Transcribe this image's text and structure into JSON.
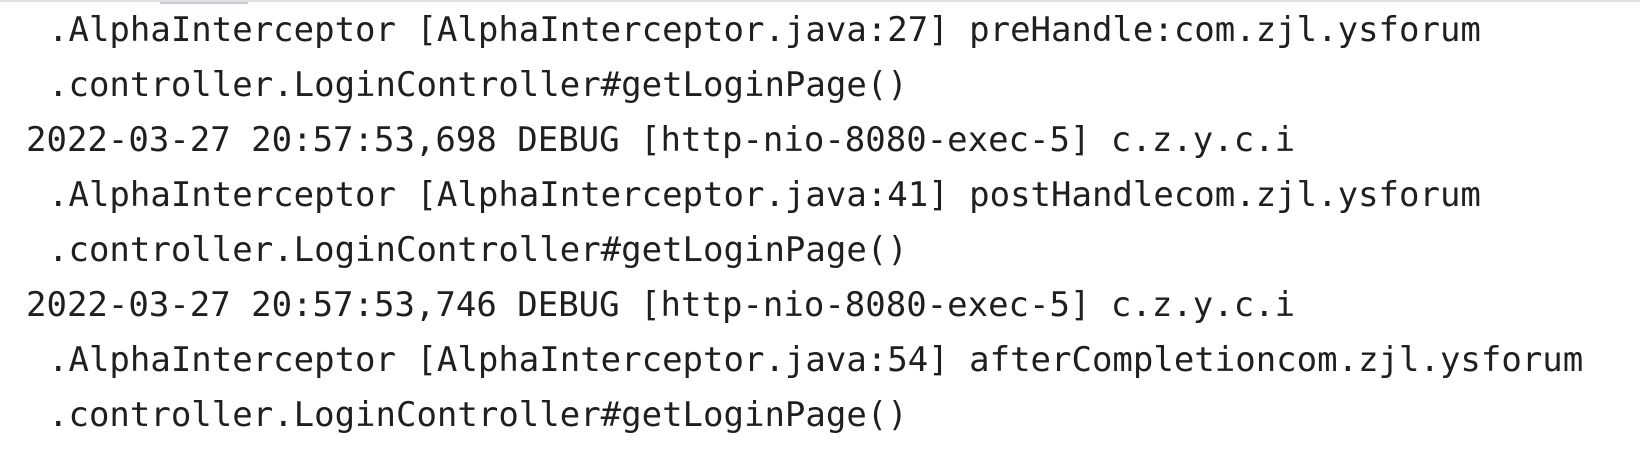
{
  "console": {
    "lines": [
      {
        "kind": "cont",
        "text": ".AlphaInterceptor [AlphaInterceptor.java:27] preHandle:com.zjl.ysforum"
      },
      {
        "kind": "cont",
        "text": ".controller.LoginController#getLoginPage()"
      },
      {
        "kind": "first",
        "text": "2022-03-27 20:57:53,698 DEBUG [http-nio-8080-exec-5] c.z.y.c.i"
      },
      {
        "kind": "cont",
        "text": ".AlphaInterceptor [AlphaInterceptor.java:41] postHandlecom.zjl.ysforum"
      },
      {
        "kind": "cont",
        "text": ".controller.LoginController#getLoginPage()"
      },
      {
        "kind": "first",
        "text": "2022-03-27 20:57:53,746 DEBUG [http-nio-8080-exec-5] c.z.y.c.i"
      },
      {
        "kind": "cont",
        "text": ".AlphaInterceptor [AlphaInterceptor.java:54] afterCompletioncom.zjl.ysforum"
      },
      {
        "kind": "cont",
        "text": ".controller.LoginController#getLoginPage()"
      }
    ]
  }
}
